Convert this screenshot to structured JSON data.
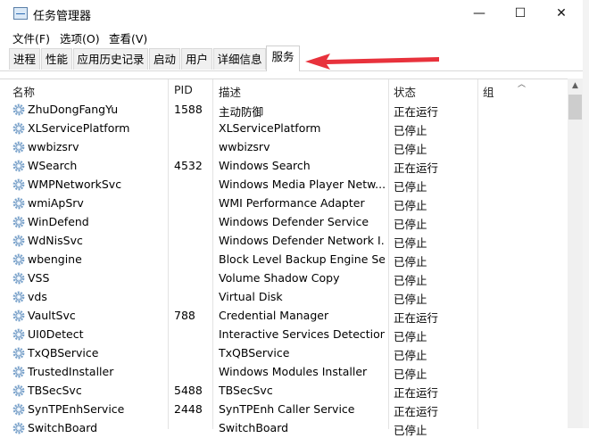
{
  "window": {
    "title": "任务管理器",
    "minimize_glyph": "—",
    "maximize_glyph": "☐",
    "close_glyph": "✕"
  },
  "menu": [
    "文件(F)",
    "选项(O)",
    "查看(V)"
  ],
  "tabs": [
    "进程",
    "性能",
    "应用历史记录",
    "启动",
    "用户",
    "详细信息",
    "服务"
  ],
  "active_tab": "服务",
  "columns": {
    "name": "名称",
    "pid": "PID",
    "description": "描述",
    "status": "状态",
    "group": "组"
  },
  "services": [
    {
      "name": "ZhuDongFangYu",
      "pid": "1588",
      "description": "主动防御",
      "status": "正在运行"
    },
    {
      "name": "XLServicePlatform",
      "pid": "",
      "description": "XLServicePlatform",
      "status": "已停止"
    },
    {
      "name": "wwbizsrv",
      "pid": "",
      "description": "wwbizsrv",
      "status": "已停止"
    },
    {
      "name": "WSearch",
      "pid": "4532",
      "description": "Windows Search",
      "status": "正在运行"
    },
    {
      "name": "WMPNetworkSvc",
      "pid": "",
      "description": "Windows Media Player Netw...",
      "status": "已停止"
    },
    {
      "name": "wmiApSrv",
      "pid": "",
      "description": "WMI Performance Adapter",
      "status": "已停止"
    },
    {
      "name": "WinDefend",
      "pid": "",
      "description": "Windows Defender Service",
      "status": "已停止"
    },
    {
      "name": "WdNisSvc",
      "pid": "",
      "description": "Windows Defender Network I...",
      "status": "已停止"
    },
    {
      "name": "wbengine",
      "pid": "",
      "description": "Block Level Backup Engine Se...",
      "status": "已停止"
    },
    {
      "name": "VSS",
      "pid": "",
      "description": "Volume Shadow Copy",
      "status": "已停止"
    },
    {
      "name": "vds",
      "pid": "",
      "description": "Virtual Disk",
      "status": "已停止"
    },
    {
      "name": "VaultSvc",
      "pid": "788",
      "description": "Credential Manager",
      "status": "正在运行"
    },
    {
      "name": "UI0Detect",
      "pid": "",
      "description": "Interactive Services Detection",
      "status": "已停止"
    },
    {
      "name": "TxQBService",
      "pid": "",
      "description": "TxQBService",
      "status": "已停止"
    },
    {
      "name": "TrustedInstaller",
      "pid": "",
      "description": "Windows Modules Installer",
      "status": "已停止"
    },
    {
      "name": "TBSecSvc",
      "pid": "5488",
      "description": "TBSecSvc",
      "status": "正在运行"
    },
    {
      "name": "SynTPEnhService",
      "pid": "2448",
      "description": "SynTPEnh Caller Service",
      "status": "正在运行"
    },
    {
      "name": "SwitchBoard",
      "pid": "",
      "description": "SwitchBoard",
      "status": "已停止"
    }
  ],
  "colors": {
    "arrow": "#e8323c",
    "gear": "#7aa3cc"
  }
}
